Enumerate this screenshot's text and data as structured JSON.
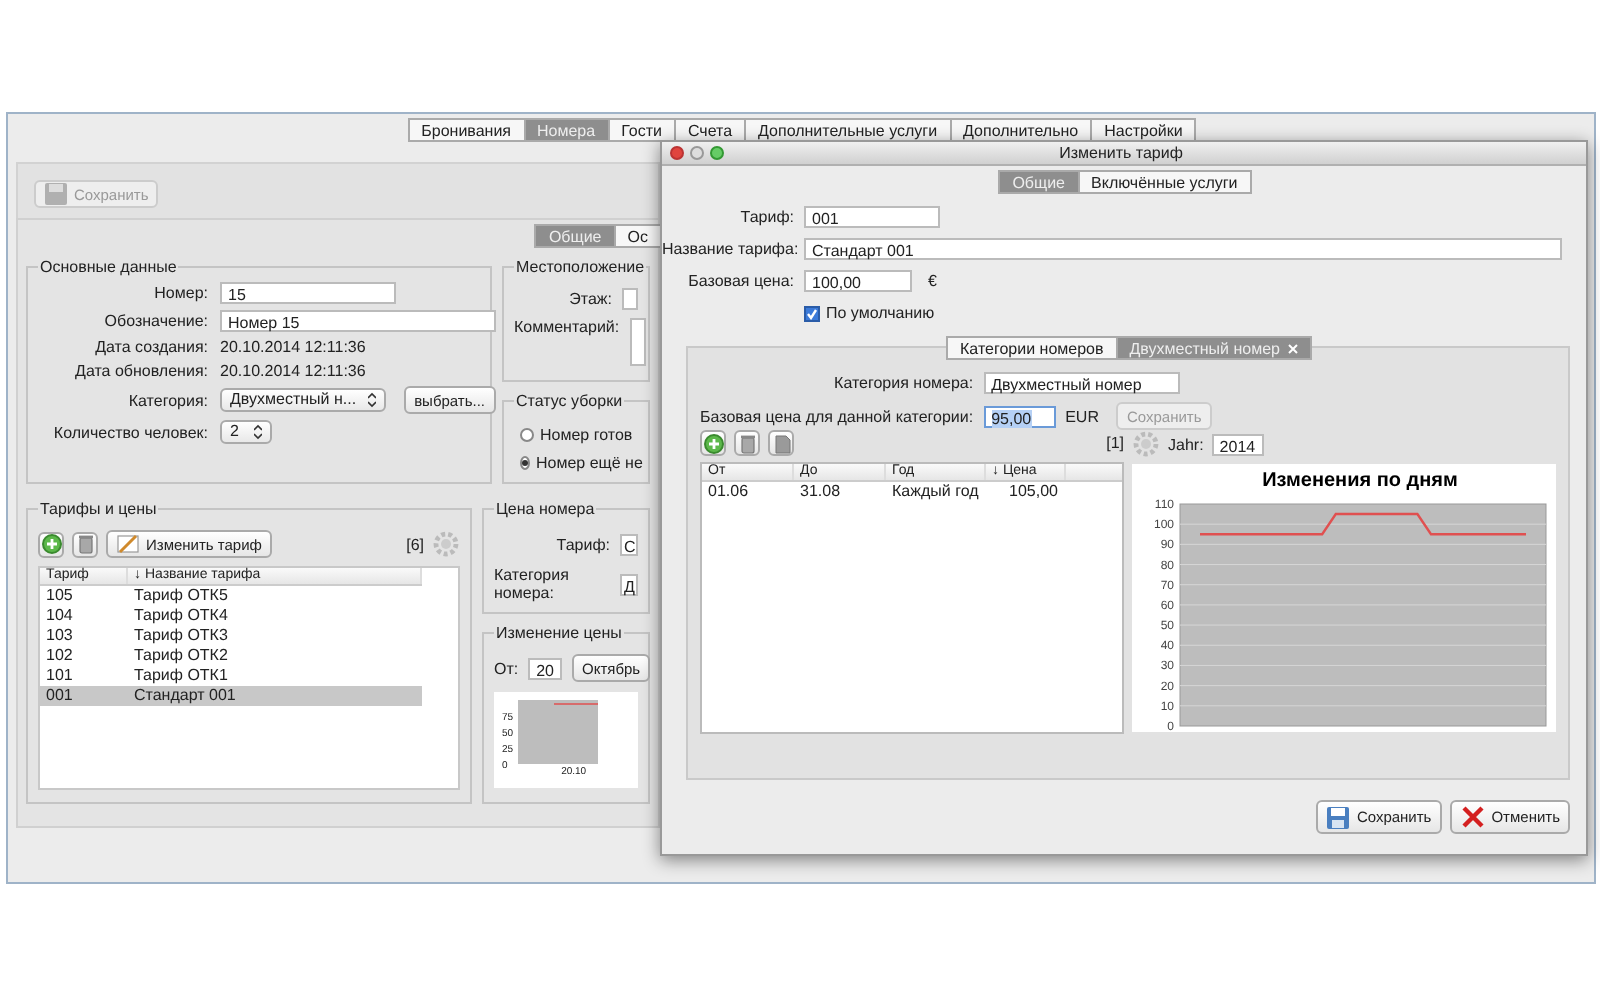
{
  "main_window": {
    "tabs": [
      {
        "label": "Бронивания",
        "selected": false
      },
      {
        "label": "Номера",
        "selected": true
      },
      {
        "label": "Гости",
        "selected": false
      },
      {
        "label": "Счета",
        "selected": false
      },
      {
        "label": "Дополнительные услуги",
        "selected": false
      },
      {
        "label": "Дополнительно",
        "selected": false
      },
      {
        "label": "Настройки",
        "selected": false
      }
    ],
    "save_button": {
      "label": "Сохранить",
      "disabled": true
    },
    "subtabs": [
      {
        "label": "Общие",
        "selected": true
      },
      {
        "label": "Ос",
        "selected": false
      }
    ],
    "basic_data": {
      "title": "Основные данные",
      "fields": [
        {
          "kind": "field",
          "label": "Номер:",
          "value": "15"
        },
        {
          "kind": "longfield",
          "label": "Обозначение:",
          "value": "Номер 15"
        },
        {
          "kind": "text",
          "label": "Дата создания:",
          "value": "20.10.2014  12:11:36"
        },
        {
          "kind": "text",
          "label": "Дата обновления:",
          "value": "20.10.2014  12:11:36"
        },
        {
          "kind": "select",
          "label": "Категория:",
          "value": "Двухместный н...",
          "button": "выбрать..."
        },
        {
          "kind": "spinner",
          "label": "Количество человек:",
          "value": "2"
        }
      ]
    },
    "location": {
      "title": "Местоположение",
      "floor_label": "Этаж:",
      "comment_label": "Комментарий:"
    },
    "cleaning": {
      "title": "Статус уборки",
      "options": [
        {
          "label": "Номер готов",
          "selected": false
        },
        {
          "label": "Номер ещё не",
          "selected": true
        }
      ]
    },
    "tariffs": {
      "title": "Тарифы и цены",
      "edit_button": "Изменить тариф",
      "count": "[6]",
      "columns": [
        "Тариф",
        "↓ Название тарифа"
      ],
      "rows": [
        {
          "cells": [
            "105",
            "Тариф ОТК5"
          ],
          "selected": false
        },
        {
          "cells": [
            "104",
            "Тариф ОТК4"
          ],
          "selected": false
        },
        {
          "cells": [
            "103",
            "Тариф ОТК3"
          ],
          "selected": false
        },
        {
          "cells": [
            "102",
            "Тариф ОТК2"
          ],
          "selected": false
        },
        {
          "cells": [
            "101",
            "Тариф ОТК1"
          ],
          "selected": false
        },
        {
          "cells": [
            "001",
            "Стандарт 001"
          ],
          "selected": true
        }
      ]
    },
    "room_price": {
      "title": "Цена номера",
      "fields": [
        {
          "label": "Тариф:",
          "value": "С"
        },
        {
          "label": "Категория номера:",
          "value": "Д"
        }
      ]
    },
    "price_change": {
      "title": "Изменение цены",
      "from_label": "От:",
      "day": "20",
      "month": "Октябрь",
      "yticks": [
        "75",
        "50",
        "25",
        "0"
      ],
      "xtick": "20.10"
    }
  },
  "dialog": {
    "title": "Изменить тариф",
    "tabs": [
      {
        "label": "Общие",
        "selected": true
      },
      {
        "label": "Включённые услуги",
        "selected": false
      }
    ],
    "fields": [
      {
        "kind": "field",
        "label": "Тариф:",
        "value": "001"
      },
      {
        "kind": "longfield",
        "label": "Название тарифа:",
        "value": "Стандарт 001"
      },
      {
        "kind": "field",
        "label": "Базовая цена:",
        "value": "100,00",
        "unit": "€"
      }
    ],
    "default_checkbox": {
      "label": "По умолчанию",
      "checked": true
    },
    "category_tabs": [
      {
        "label": "Категории номеров",
        "selected": false,
        "closable": false
      },
      {
        "label": "Двухместный номер",
        "selected": true,
        "closable": true
      }
    ],
    "category": {
      "label": "Категория номера:",
      "value": "Двухместный номер"
    },
    "category_price": {
      "label": "Базовая цена для данной категории:",
      "value": "95,00",
      "unit": "EUR",
      "save_button": {
        "label": "Сохранить",
        "disabled": true
      }
    },
    "count": "[1]",
    "year_label": "Jahr:",
    "year": "2014",
    "periods": {
      "columns": [
        "От",
        "До",
        "Год",
        "↓ Цена"
      ],
      "rows": [
        [
          "01.06",
          "31.08",
          "Каждый год",
          "105,00"
        ]
      ]
    },
    "chart_data": {
      "type": "line",
      "title": "Изменения по дням",
      "categories": [
        null,
        null,
        null,
        null,
        null,
        null,
        null,
        null,
        null,
        null,
        null,
        null,
        null,
        null,
        null,
        null,
        null,
        null,
        null,
        null,
        null,
        null,
        null,
        null,
        null
      ],
      "series": [
        {
          "color": "#e05050",
          "values": [
            95,
            95,
            95,
            95,
            95,
            95,
            95,
            95,
            95,
            95,
            105,
            105,
            105,
            105,
            105,
            105,
            105,
            95,
            95,
            95,
            95,
            95,
            95,
            95,
            95
          ]
        }
      ],
      "grid": true,
      "ylim": [
        0,
        110
      ],
      "yticks": [
        0,
        10,
        20,
        30,
        40,
        50,
        60,
        70,
        80,
        90,
        100,
        110
      ]
    },
    "buttons": [
      {
        "kind": "save",
        "label": "Сохранить"
      },
      {
        "kind": "cancel",
        "label": "Отменить"
      }
    ]
  }
}
